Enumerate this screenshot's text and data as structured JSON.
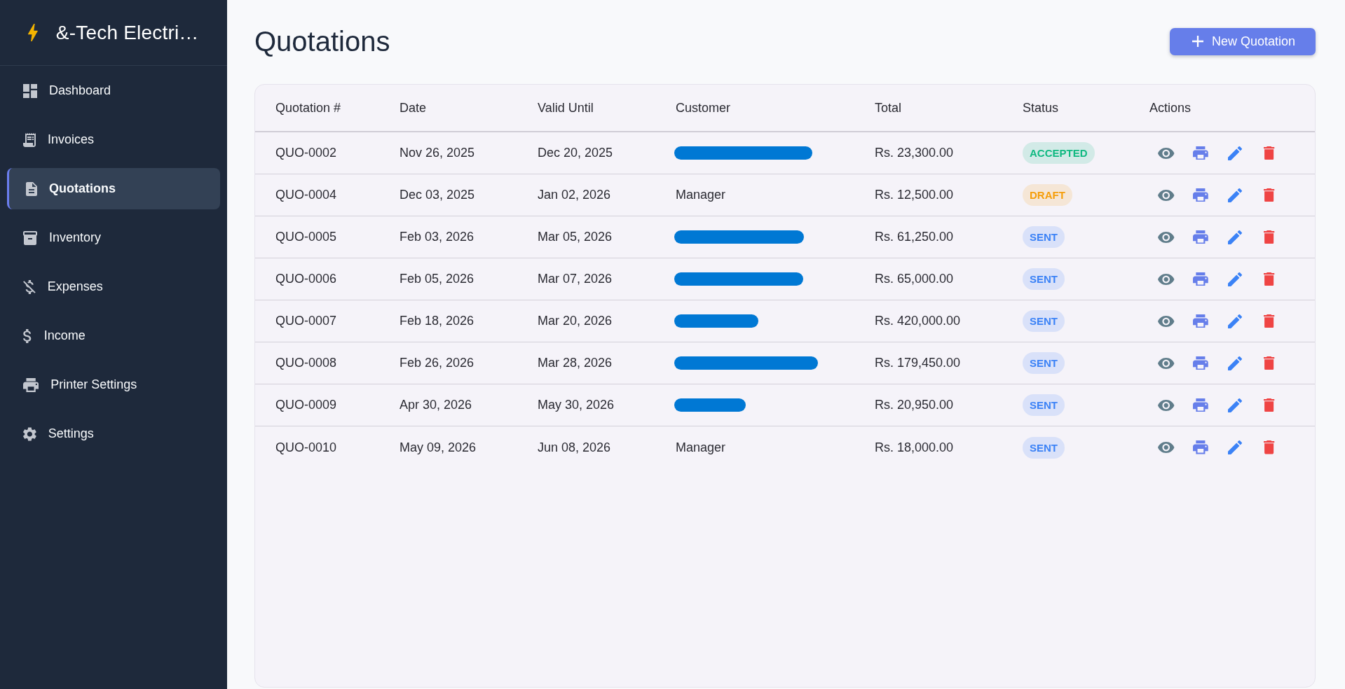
{
  "sidebar": {
    "brand": "&-Tech Electri…",
    "items": [
      {
        "label": "Dashboard",
        "selected": false
      },
      {
        "label": "Invoices",
        "selected": false
      },
      {
        "label": "Quotations",
        "selected": true
      },
      {
        "label": "Inventory",
        "selected": false
      },
      {
        "label": "Expenses",
        "selected": false
      },
      {
        "label": "Income",
        "selected": false
      },
      {
        "label": "Printer Settings",
        "selected": false
      },
      {
        "label": "Settings",
        "selected": false
      }
    ]
  },
  "page": {
    "title": "Quotations",
    "new_button": "New Quotation"
  },
  "table": {
    "columns": [
      "Quotation #",
      "Date",
      "Valid Until",
      "Customer",
      "Total",
      "Status",
      "Actions"
    ],
    "rows": [
      {
        "number": "QUO-0002",
        "date": "Nov 26, 2025",
        "valid_until": "Dec 20, 2025",
        "customer": {
          "redacted": true
        },
        "total": "Rs. 23,300.00",
        "status": {
          "label": "ACCEPTED",
          "color": "#10b981"
        }
      },
      {
        "number": "QUO-0004",
        "date": "Dec 03, 2025",
        "valid_until": "Jan 02, 2026",
        "customer": {
          "redacted": false,
          "text": "Manager"
        },
        "total": "Rs. 12,500.00",
        "status": {
          "label": "DRAFT",
          "color": "#f59e0b"
        }
      },
      {
        "number": "QUO-0005",
        "date": "Feb 03, 2026",
        "valid_until": "Mar 05, 2026",
        "customer": {
          "redacted": true
        },
        "total": "Rs. 61,250.00",
        "status": {
          "label": "SENT",
          "color": "#3b82f6"
        }
      },
      {
        "number": "QUO-0006",
        "date": "Feb 05, 2026",
        "valid_until": "Mar 07, 2026",
        "customer": {
          "redacted": true
        },
        "total": "Rs. 65,000.00",
        "status": {
          "label": "SENT",
          "color": "#3b82f6"
        }
      },
      {
        "number": "QUO-0007",
        "date": "Feb 18, 2026",
        "valid_until": "Mar 20, 2026",
        "customer": {
          "redacted": true
        },
        "total": "Rs. 420,000.00",
        "status": {
          "label": "SENT",
          "color": "#3b82f6"
        }
      },
      {
        "number": "QUO-0008",
        "date": "Feb 26, 2026",
        "valid_until": "Mar 28, 2026",
        "customer": {
          "redacted": true
        },
        "total": "Rs. 179,450.00",
        "status": {
          "label": "SENT",
          "color": "#3b82f6"
        }
      },
      {
        "number": "QUO-0009",
        "date": "Apr 30, 2026",
        "valid_until": "May 30, 2026",
        "customer": {
          "redacted": true
        },
        "total": "Rs. 20,950.00",
        "status": {
          "label": "SENT",
          "color": "#3b82f6"
        }
      },
      {
        "number": "QUO-0010",
        "date": "May 09, 2026",
        "valid_until": "Jun 08, 2026",
        "customer": {
          "redacted": false,
          "text": "Manager"
        },
        "total": "Rs. 18,000.00",
        "status": {
          "label": "SENT",
          "color": "#3b82f6"
        }
      }
    ]
  }
}
